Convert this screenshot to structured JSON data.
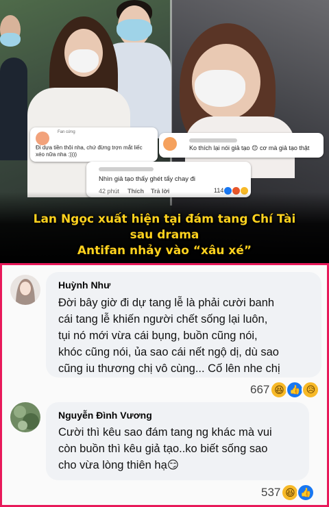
{
  "banner": {
    "headline_line1": "Lan Ngọc xuất hiện tại đám tang Chí Tài",
    "headline_line2": "sau drama",
    "headline_line3": "Antifan nhảy vào “xâu xé”",
    "headline_color": "#ffd21e",
    "mini_comments": [
      {
        "tag": "Fan cứng",
        "text_line1": "Đi dựa tiền thôi nha, chứ đừng trợn mắt liếc",
        "text_line2": "xéo nữa nha :))))"
      },
      {
        "text": "Ko thích lại nói giả tạo 😊 cơ mà giả tạo thật"
      },
      {
        "text": "Nhìn giả tạo thấy ghét tẩy chay đi",
        "time": "42 phút",
        "like": "Thích",
        "reply": "Trả lời",
        "reactions": "114"
      }
    ]
  },
  "comments": [
    {
      "name": "Huỳnh Như",
      "lines": [
        "Đời bây giờ đi dự tang lễ là phải cười banh",
        "cái tang lễ khiến người chết sống lại luôn,",
        "tụi nó mới vừa cái bụng, buồn cũng nói,",
        "khóc cũng nói, ủa sao cái nết ngộ dị, dù sao",
        "cũng iu thương chị vô cùng... Cố lên nhe chị"
      ],
      "reaction_count": "667",
      "reaction_icons": [
        "haha-icon",
        "like-icon",
        "sad-icon"
      ]
    },
    {
      "name": "Nguyễn Đình Vương",
      "lines": [
        "Cười thì kêu sao đám tang ng khác mà vui",
        "còn buồn thì kêu giả tạo..ko biết sống sao",
        "cho vừa lòng thiên hạ😏"
      ],
      "reaction_count": "537",
      "reaction_icons": [
        "haha-icon",
        "like-icon"
      ]
    }
  ],
  "colors": {
    "panel_border": "#e8195a",
    "bubble_bg": "#f0f2f5",
    "like_blue": "#1877f2",
    "haha_yellow": "#f7b928"
  }
}
